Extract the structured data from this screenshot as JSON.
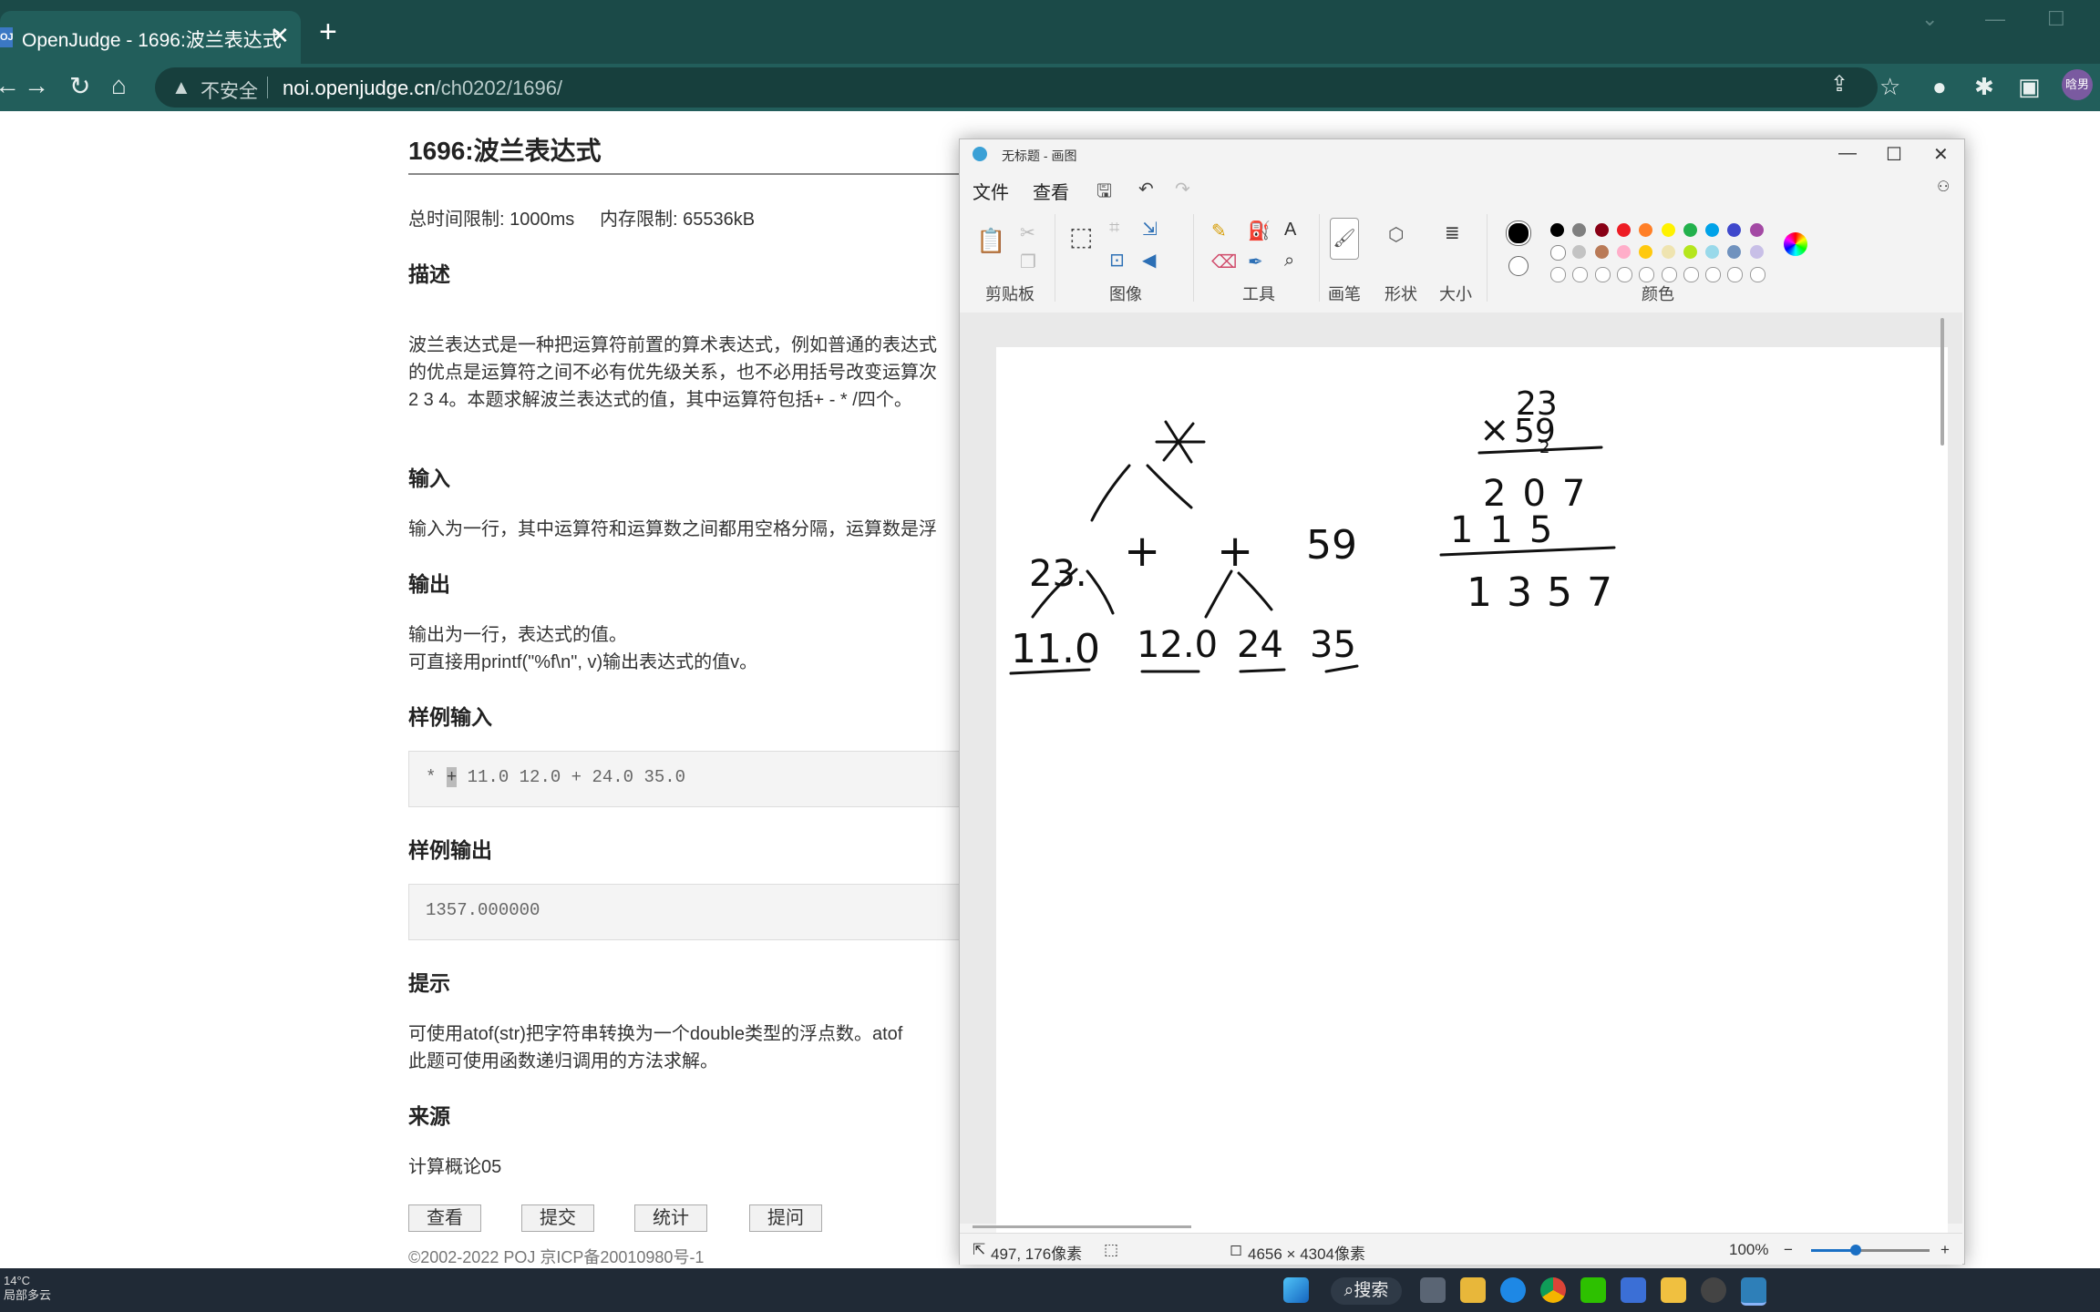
{
  "browser": {
    "tab_favicon": "OJ",
    "tab_title": "OpenJudge - 1696:波兰表达式",
    "tab_close": "✕",
    "new_tab": "+",
    "insecure_label": "不安全",
    "url_host": "noi.openjudge.cn",
    "url_path": "/ch0202/1696/",
    "avatar_text": "晗男",
    "colors": {
      "tabbar": "#1b4a48",
      "toolbar": "#225e5b"
    }
  },
  "problem": {
    "title": "1696:波兰表达式",
    "limits": "总时间限制: 1000ms     内存限制: 65536kB",
    "desc_heading": "描述",
    "desc_lines": [
      "波兰表达式是一种把运算符前置的算术表达式，例如普通的表达式",
      "的优点是运算符之间不必有优先级关系，也不必用括号改变运算次",
      "2 3 4。本题求解波兰表达式的值，其中运算符包括+ - * /四个。"
    ],
    "input_heading": "输入",
    "input_text": "输入为一行，其中运算符和运算数之间都用空格分隔，运算数是浮",
    "output_heading": "输出",
    "output_lines": [
      "输出为一行，表达式的值。",
      "可直接用printf(\"%f\\n\", v)输出表达式的值v。"
    ],
    "sample_in_heading": "样例输入",
    "sample_in_star": "*",
    "sample_in_plus": "+",
    "sample_in_rest": "11.0 12.0 + 24.0 35.0",
    "sample_out_heading": "样例输出",
    "sample_out": "1357.000000",
    "hint_heading": "提示",
    "hint_lines": [
      "可使用atof(str)把字符串转换为一个double类型的浮点数。atof",
      "此题可使用函数递归调用的方法求解。"
    ],
    "source_heading": "来源",
    "source_text": "计算概论05",
    "buttons": [
      "查看",
      "提交",
      "统计",
      "提问"
    ],
    "footer": "©2002-2022 POJ 京ICP备20010980号-1"
  },
  "paint": {
    "title": "无标题 - 画图",
    "menu": [
      "文件",
      "查看"
    ],
    "groups": [
      "剪贴板",
      "图像",
      "工具",
      "画笔",
      "形状",
      "大小",
      "颜色"
    ],
    "status_pos": "497, 176像素",
    "status_size": "4656 × 4304像素",
    "zoom": "100%",
    "zoom_fraction": 0.38,
    "palette": [
      "#000000",
      "#7f7f7f",
      "#880015",
      "#ed1c24",
      "#ff7f27",
      "#fff200",
      "#22b14c",
      "#00a2e8",
      "#3f48cc",
      "#a349a4",
      "#ffffff",
      "#c3c3c3",
      "#b97a57",
      "#ffaec9",
      "#ffc90e",
      "#efe4b0",
      "#b5e61d",
      "#99d9ea",
      "#7092be",
      "#c8bfe7"
    ],
    "drawing": {
      "tree_root": "*",
      "tree_ops": [
        "+",
        "+"
      ],
      "left_num": "23.",
      "right_num": "59",
      "leaves": [
        "11.0",
        "12.0",
        "24",
        "35"
      ],
      "multiplicand": "23",
      "multiplier": "59",
      "carry": "2",
      "partial1": "207",
      "partial2": "115",
      "result": "1357"
    }
  },
  "taskbar": {
    "weather_temp": "14°C",
    "weather_desc": "局部多云",
    "search_label": "搜索"
  }
}
